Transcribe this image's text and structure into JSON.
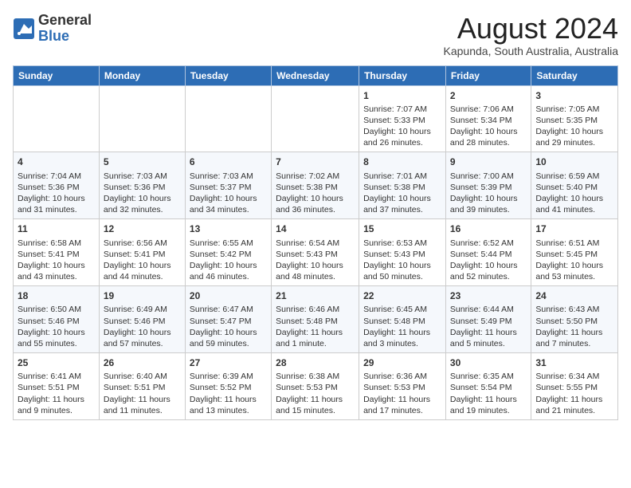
{
  "header": {
    "logo_line1": "General",
    "logo_line2": "Blue",
    "month_year": "August 2024",
    "location": "Kapunda, South Australia, Australia"
  },
  "days_of_week": [
    "Sunday",
    "Monday",
    "Tuesday",
    "Wednesday",
    "Thursday",
    "Friday",
    "Saturday"
  ],
  "weeks": [
    [
      {
        "day": "",
        "data": ""
      },
      {
        "day": "",
        "data": ""
      },
      {
        "day": "",
        "data": ""
      },
      {
        "day": "",
        "data": ""
      },
      {
        "day": "1",
        "data": "Sunrise: 7:07 AM\nSunset: 5:33 PM\nDaylight: 10 hours\nand 26 minutes."
      },
      {
        "day": "2",
        "data": "Sunrise: 7:06 AM\nSunset: 5:34 PM\nDaylight: 10 hours\nand 28 minutes."
      },
      {
        "day": "3",
        "data": "Sunrise: 7:05 AM\nSunset: 5:35 PM\nDaylight: 10 hours\nand 29 minutes."
      }
    ],
    [
      {
        "day": "4",
        "data": "Sunrise: 7:04 AM\nSunset: 5:36 PM\nDaylight: 10 hours\nand 31 minutes."
      },
      {
        "day": "5",
        "data": "Sunrise: 7:03 AM\nSunset: 5:36 PM\nDaylight: 10 hours\nand 32 minutes."
      },
      {
        "day": "6",
        "data": "Sunrise: 7:03 AM\nSunset: 5:37 PM\nDaylight: 10 hours\nand 34 minutes."
      },
      {
        "day": "7",
        "data": "Sunrise: 7:02 AM\nSunset: 5:38 PM\nDaylight: 10 hours\nand 36 minutes."
      },
      {
        "day": "8",
        "data": "Sunrise: 7:01 AM\nSunset: 5:38 PM\nDaylight: 10 hours\nand 37 minutes."
      },
      {
        "day": "9",
        "data": "Sunrise: 7:00 AM\nSunset: 5:39 PM\nDaylight: 10 hours\nand 39 minutes."
      },
      {
        "day": "10",
        "data": "Sunrise: 6:59 AM\nSunset: 5:40 PM\nDaylight: 10 hours\nand 41 minutes."
      }
    ],
    [
      {
        "day": "11",
        "data": "Sunrise: 6:58 AM\nSunset: 5:41 PM\nDaylight: 10 hours\nand 43 minutes."
      },
      {
        "day": "12",
        "data": "Sunrise: 6:56 AM\nSunset: 5:41 PM\nDaylight: 10 hours\nand 44 minutes."
      },
      {
        "day": "13",
        "data": "Sunrise: 6:55 AM\nSunset: 5:42 PM\nDaylight: 10 hours\nand 46 minutes."
      },
      {
        "day": "14",
        "data": "Sunrise: 6:54 AM\nSunset: 5:43 PM\nDaylight: 10 hours\nand 48 minutes."
      },
      {
        "day": "15",
        "data": "Sunrise: 6:53 AM\nSunset: 5:43 PM\nDaylight: 10 hours\nand 50 minutes."
      },
      {
        "day": "16",
        "data": "Sunrise: 6:52 AM\nSunset: 5:44 PM\nDaylight: 10 hours\nand 52 minutes."
      },
      {
        "day": "17",
        "data": "Sunrise: 6:51 AM\nSunset: 5:45 PM\nDaylight: 10 hours\nand 53 minutes."
      }
    ],
    [
      {
        "day": "18",
        "data": "Sunrise: 6:50 AM\nSunset: 5:46 PM\nDaylight: 10 hours\nand 55 minutes."
      },
      {
        "day": "19",
        "data": "Sunrise: 6:49 AM\nSunset: 5:46 PM\nDaylight: 10 hours\nand 57 minutes."
      },
      {
        "day": "20",
        "data": "Sunrise: 6:47 AM\nSunset: 5:47 PM\nDaylight: 10 hours\nand 59 minutes."
      },
      {
        "day": "21",
        "data": "Sunrise: 6:46 AM\nSunset: 5:48 PM\nDaylight: 11 hours\nand 1 minute."
      },
      {
        "day": "22",
        "data": "Sunrise: 6:45 AM\nSunset: 5:48 PM\nDaylight: 11 hours\nand 3 minutes."
      },
      {
        "day": "23",
        "data": "Sunrise: 6:44 AM\nSunset: 5:49 PM\nDaylight: 11 hours\nand 5 minutes."
      },
      {
        "day": "24",
        "data": "Sunrise: 6:43 AM\nSunset: 5:50 PM\nDaylight: 11 hours\nand 7 minutes."
      }
    ],
    [
      {
        "day": "25",
        "data": "Sunrise: 6:41 AM\nSunset: 5:51 PM\nDaylight: 11 hours\nand 9 minutes."
      },
      {
        "day": "26",
        "data": "Sunrise: 6:40 AM\nSunset: 5:51 PM\nDaylight: 11 hours\nand 11 minutes."
      },
      {
        "day": "27",
        "data": "Sunrise: 6:39 AM\nSunset: 5:52 PM\nDaylight: 11 hours\nand 13 minutes."
      },
      {
        "day": "28",
        "data": "Sunrise: 6:38 AM\nSunset: 5:53 PM\nDaylight: 11 hours\nand 15 minutes."
      },
      {
        "day": "29",
        "data": "Sunrise: 6:36 AM\nSunset: 5:53 PM\nDaylight: 11 hours\nand 17 minutes."
      },
      {
        "day": "30",
        "data": "Sunrise: 6:35 AM\nSunset: 5:54 PM\nDaylight: 11 hours\nand 19 minutes."
      },
      {
        "day": "31",
        "data": "Sunrise: 6:34 AM\nSunset: 5:55 PM\nDaylight: 11 hours\nand 21 minutes."
      }
    ]
  ]
}
